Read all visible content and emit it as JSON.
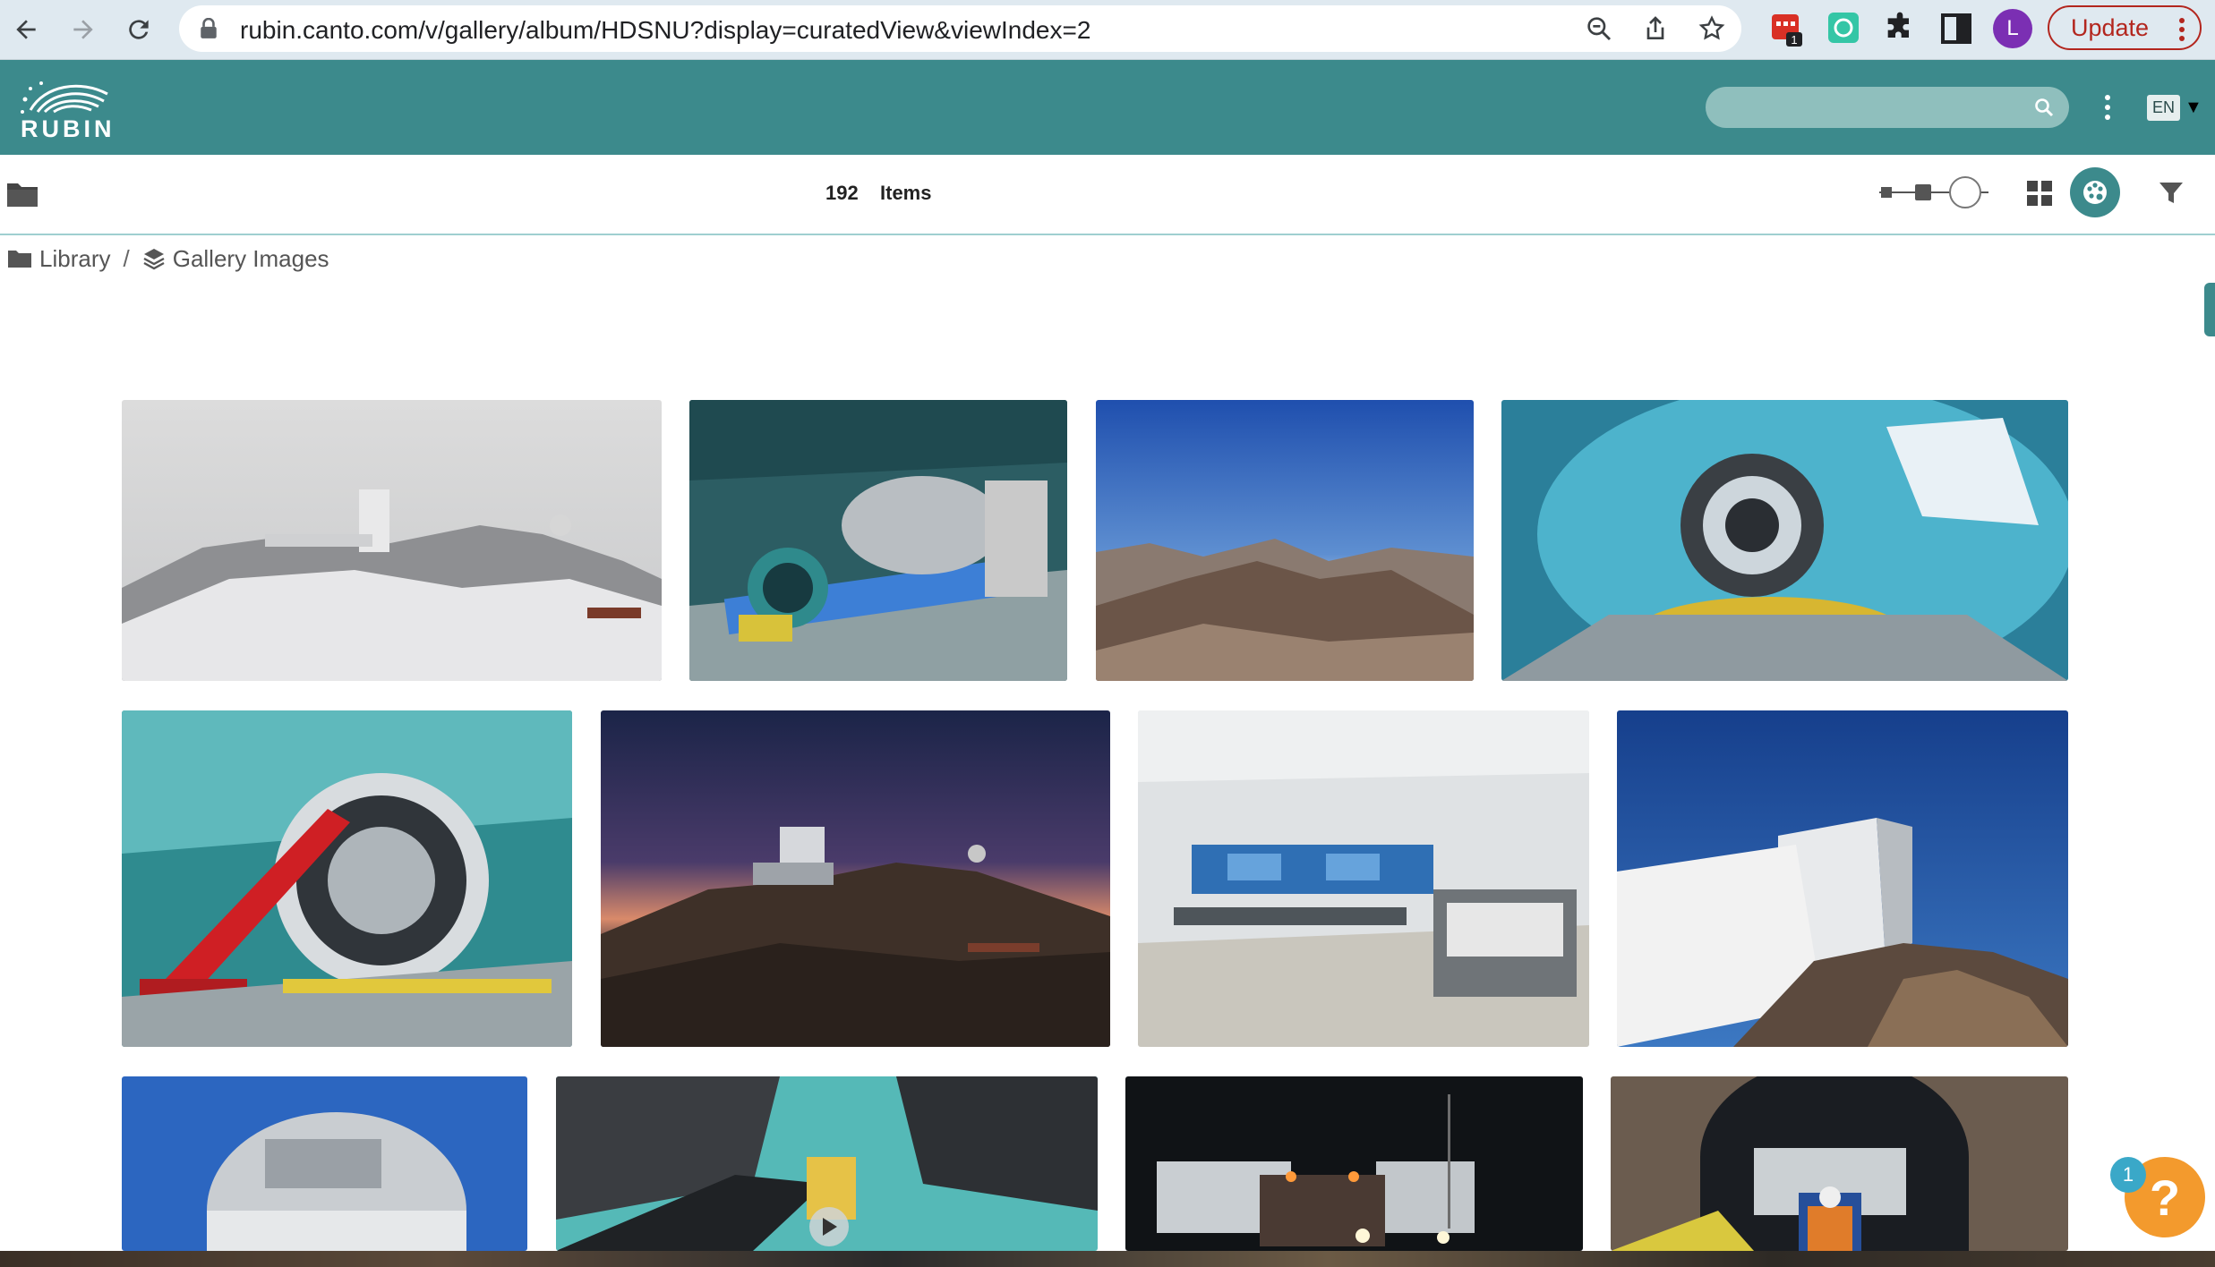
{
  "browser": {
    "url": "rubin.canto.com/v/gallery/album/HDSNU?display=curatedView&viewIndex=2",
    "profile_initial": "L",
    "update_label": "Update",
    "extension_badge": "1"
  },
  "header": {
    "logo_text": "RUBIN",
    "search_placeholder": "",
    "language": "EN"
  },
  "toolbar": {
    "item_count": "192",
    "item_label": "Items"
  },
  "breadcrumb": [
    {
      "label": "Library",
      "icon": "folder-icon"
    },
    {
      "label": "Gallery Images",
      "icon": "layers-icon"
    }
  ],
  "gallery": {
    "rows": [
      [
        "snowy-summit-observatory",
        "telescope-assembly-hall",
        "blue-sky-mountains",
        "fisheye-telescope-dome"
      ],
      [
        "red-lift-telescope-ring",
        "twilight-observatory",
        "control-room",
        "observatory-building-blue-sky"
      ],
      [
        "dome-blue-sky",
        "mirror-segments-video",
        "night-convoy-truck",
        "tunnel-convoy-worker"
      ]
    ]
  },
  "help": {
    "label": "?",
    "badge": "1"
  },
  "colors": {
    "header_bg": "#3c8a8c",
    "help_bg": "#f39a2d",
    "update_red": "#b3261e"
  }
}
